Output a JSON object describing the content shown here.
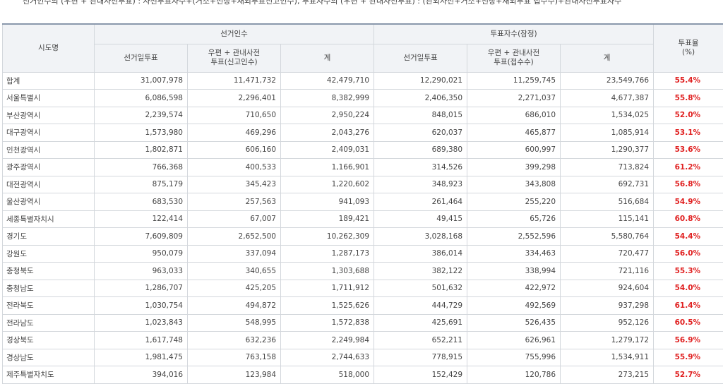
{
  "note": "선거인수의 (우편 + 관내사전투표) : 사전투표자수+(거소+선상+재외투표신고인수), 투표자수의 (우편 + 관내사전투표) : (관외사전+거소+선상+재외투표 접수수)+관내사전투표자수",
  "headers": {
    "region": "시도명",
    "electors_group": "선거인수",
    "voters_group": "투표자수(잠정)",
    "rate": "투표율\n(%)",
    "electors_day": "선거일투표",
    "electors_mail": "우편 + 관내사전\n투표(신고인수)",
    "electors_total": "계",
    "voters_day": "선거일투표",
    "voters_mail": "우편 + 관내사전\n투표(접수수)",
    "voters_total": "계"
  },
  "rows": [
    {
      "region": "합계",
      "e_day": "31,007,978",
      "e_mail": "11,471,732",
      "e_total": "42,479,710",
      "v_day": "12,290,021",
      "v_mail": "11,259,745",
      "v_total": "23,549,766",
      "rate": "55.4%"
    },
    {
      "region": "서울특별시",
      "e_day": "6,086,598",
      "e_mail": "2,296,401",
      "e_total": "8,382,999",
      "v_day": "2,406,350",
      "v_mail": "2,271,037",
      "v_total": "4,677,387",
      "rate": "55.8%"
    },
    {
      "region": "부산광역시",
      "e_day": "2,239,574",
      "e_mail": "710,650",
      "e_total": "2,950,224",
      "v_day": "848,015",
      "v_mail": "686,010",
      "v_total": "1,534,025",
      "rate": "52.0%"
    },
    {
      "region": "대구광역시",
      "e_day": "1,573,980",
      "e_mail": "469,296",
      "e_total": "2,043,276",
      "v_day": "620,037",
      "v_mail": "465,877",
      "v_total": "1,085,914",
      "rate": "53.1%"
    },
    {
      "region": "인천광역시",
      "e_day": "1,802,871",
      "e_mail": "606,160",
      "e_total": "2,409,031",
      "v_day": "689,380",
      "v_mail": "600,997",
      "v_total": "1,290,377",
      "rate": "53.6%"
    },
    {
      "region": "광주광역시",
      "e_day": "766,368",
      "e_mail": "400,533",
      "e_total": "1,166,901",
      "v_day": "314,526",
      "v_mail": "399,298",
      "v_total": "713,824",
      "rate": "61.2%"
    },
    {
      "region": "대전광역시",
      "e_day": "875,179",
      "e_mail": "345,423",
      "e_total": "1,220,602",
      "v_day": "348,923",
      "v_mail": "343,808",
      "v_total": "692,731",
      "rate": "56.8%"
    },
    {
      "region": "울산광역시",
      "e_day": "683,530",
      "e_mail": "257,563",
      "e_total": "941,093",
      "v_day": "261,464",
      "v_mail": "255,220",
      "v_total": "516,684",
      "rate": "54.9%"
    },
    {
      "region": "세종특별자치시",
      "e_day": "122,414",
      "e_mail": "67,007",
      "e_total": "189,421",
      "v_day": "49,415",
      "v_mail": "65,726",
      "v_total": "115,141",
      "rate": "60.8%"
    },
    {
      "region": "경기도",
      "e_day": "7,609,809",
      "e_mail": "2,652,500",
      "e_total": "10,262,309",
      "v_day": "3,028,168",
      "v_mail": "2,552,596",
      "v_total": "5,580,764",
      "rate": "54.4%"
    },
    {
      "region": "강원도",
      "e_day": "950,079",
      "e_mail": "337,094",
      "e_total": "1,287,173",
      "v_day": "386,014",
      "v_mail": "334,463",
      "v_total": "720,477",
      "rate": "56.0%"
    },
    {
      "region": "충청북도",
      "e_day": "963,033",
      "e_mail": "340,655",
      "e_total": "1,303,688",
      "v_day": "382,122",
      "v_mail": "338,994",
      "v_total": "721,116",
      "rate": "55.3%"
    },
    {
      "region": "충청남도",
      "e_day": "1,286,707",
      "e_mail": "425,205",
      "e_total": "1,711,912",
      "v_day": "501,632",
      "v_mail": "422,972",
      "v_total": "924,604",
      "rate": "54.0%"
    },
    {
      "region": "전라북도",
      "e_day": "1,030,754",
      "e_mail": "494,872",
      "e_total": "1,525,626",
      "v_day": "444,729",
      "v_mail": "492,569",
      "v_total": "937,298",
      "rate": "61.4%"
    },
    {
      "region": "전라남도",
      "e_day": "1,023,843",
      "e_mail": "548,995",
      "e_total": "1,572,838",
      "v_day": "425,691",
      "v_mail": "526,435",
      "v_total": "952,126",
      "rate": "60.5%"
    },
    {
      "region": "경상북도",
      "e_day": "1,617,748",
      "e_mail": "632,236",
      "e_total": "2,249,984",
      "v_day": "652,211",
      "v_mail": "626,961",
      "v_total": "1,279,172",
      "rate": "56.9%"
    },
    {
      "region": "경상남도",
      "e_day": "1,981,475",
      "e_mail": "763,158",
      "e_total": "2,744,633",
      "v_day": "778,915",
      "v_mail": "755,996",
      "v_total": "1,534,911",
      "rate": "55.9%"
    },
    {
      "region": "제주특별자치도",
      "e_day": "394,016",
      "e_mail": "123,984",
      "e_total": "518,000",
      "v_day": "152,429",
      "v_mail": "120,786",
      "v_total": "273,215",
      "rate": "52.7%"
    }
  ]
}
